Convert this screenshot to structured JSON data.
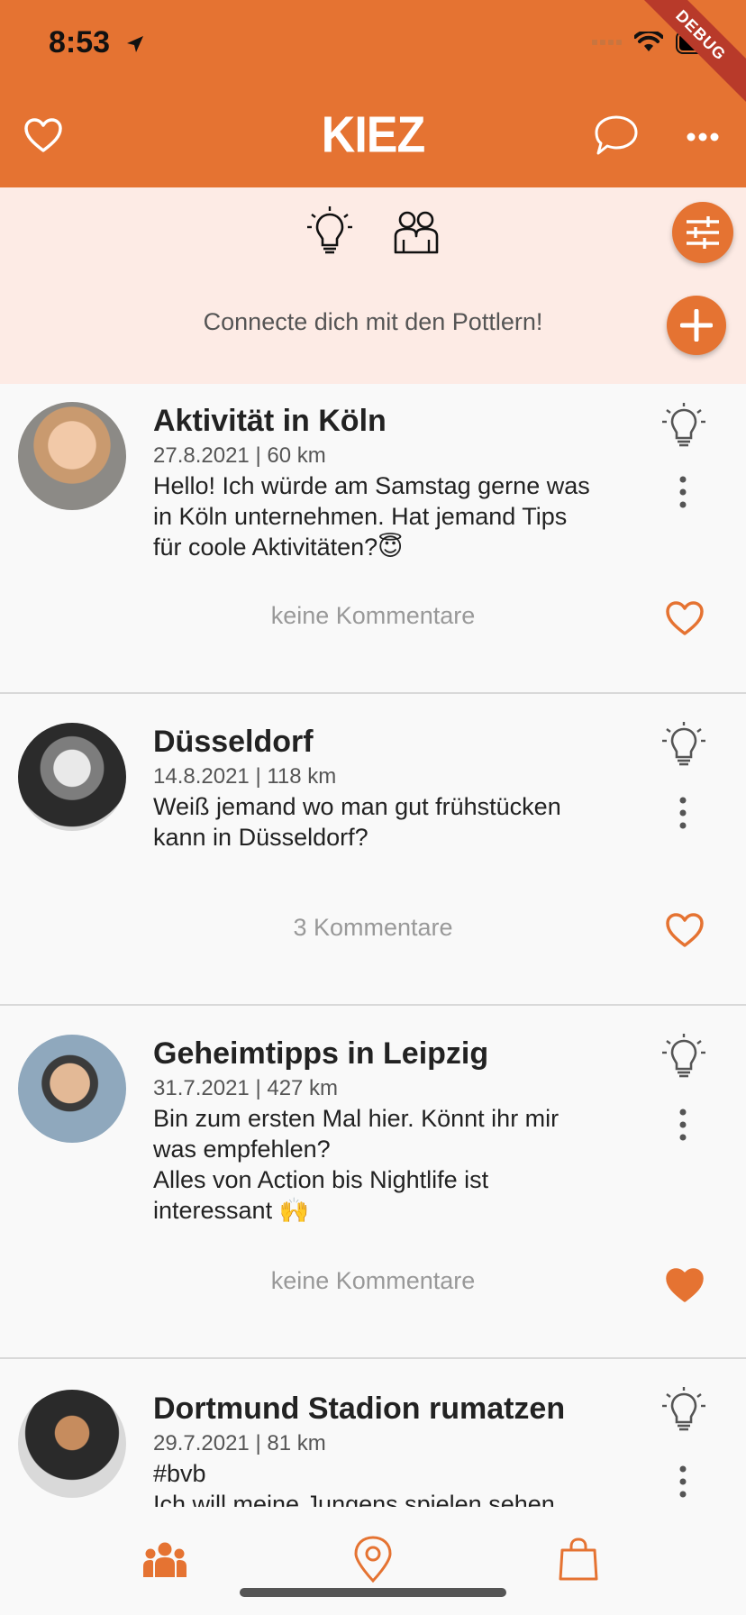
{
  "status_bar": {
    "time": "8:53"
  },
  "debug_banner": "DEBUG",
  "appbar": {
    "title": "KIEZ",
    "left_icon": "heart-outline-icon",
    "right_icons": [
      "chat-bubble-icon",
      "more-horizontal-icon"
    ]
  },
  "filter": {
    "tagline": "Connecte dich mit den Pottlern!",
    "icons": [
      "lightbulb-icon",
      "people-icon",
      "tune-icon",
      "add-icon"
    ]
  },
  "posts": [
    {
      "title": "Aktivität in Köln",
      "meta": "27.8.2021 | 60 km",
      "body": "Hello! Ich würde am Samstag gerne was\nin Köln unternehmen. Hat jemand Tips\nfür coole Aktivitäten?😇",
      "comments": "keine Kommentare",
      "liked": false
    },
    {
      "title": "Düsseldorf",
      "meta": "14.8.2021 | 118 km",
      "body": "Weiß jemand wo man gut frühstücken\nkann in Düsseldorf?",
      "comments": "3 Kommentare",
      "liked": false
    },
    {
      "title": "Geheimtipps in Leipzig",
      "meta": "31.7.2021 | 427 km",
      "body": "Bin zum ersten Mal hier. Könnt ihr mir\nwas empfehlen?\nAlles von Action bis Nightlife ist\ninteressant 🙌",
      "comments": "keine Kommentare",
      "liked": true
    },
    {
      "title": "Dortmund Stadion rumatzen",
      "meta": "29.7.2021 | 81 km",
      "body": "#bvb\nIch will meine Jungens spielen sehen",
      "comments": "",
      "liked": false
    }
  ],
  "bottom_nav": {
    "items": [
      "community-icon",
      "location-pin-icon",
      "shopping-bag-icon"
    ]
  },
  "colors": {
    "accent": "#e57332",
    "filter_bg": "#fdebe5",
    "feed_bg": "#f9f9f9"
  }
}
